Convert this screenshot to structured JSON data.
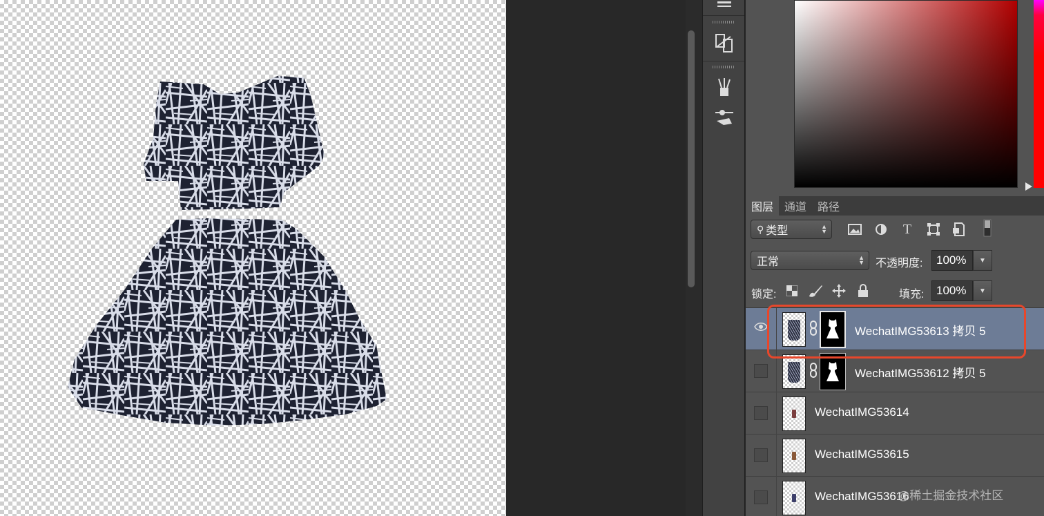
{
  "tabs": [
    {
      "label": "图层",
      "active": true
    },
    {
      "label": "通道",
      "active": false
    },
    {
      "label": "路径",
      "active": false
    }
  ],
  "filter": {
    "kind_label": "类型"
  },
  "blend": {
    "mode": "正常",
    "opacity_label": "不透明度:",
    "opacity_value": "100%"
  },
  "lock": {
    "label": "锁定:",
    "fill_label": "填充:",
    "fill_value": "100%"
  },
  "layers": [
    {
      "name": "WechatIMG53613 拷贝 5",
      "visible": true,
      "selected": true,
      "has_mask": true
    },
    {
      "name": "WechatIMG53612 拷贝 5",
      "visible": false,
      "selected": false,
      "has_mask": true
    },
    {
      "name": "WechatIMG53614",
      "visible": false,
      "selected": false,
      "has_mask": false
    },
    {
      "name": "WechatIMG53615",
      "visible": false,
      "selected": false,
      "has_mask": false
    },
    {
      "name": "WechatIMG53616",
      "visible": false,
      "selected": false,
      "has_mask": false
    }
  ],
  "watermark": "@稀土掘金技术社区",
  "colors": {
    "selection": "#6d7c96",
    "highlight": "#e8472b",
    "picker_hue": "#b10000"
  }
}
